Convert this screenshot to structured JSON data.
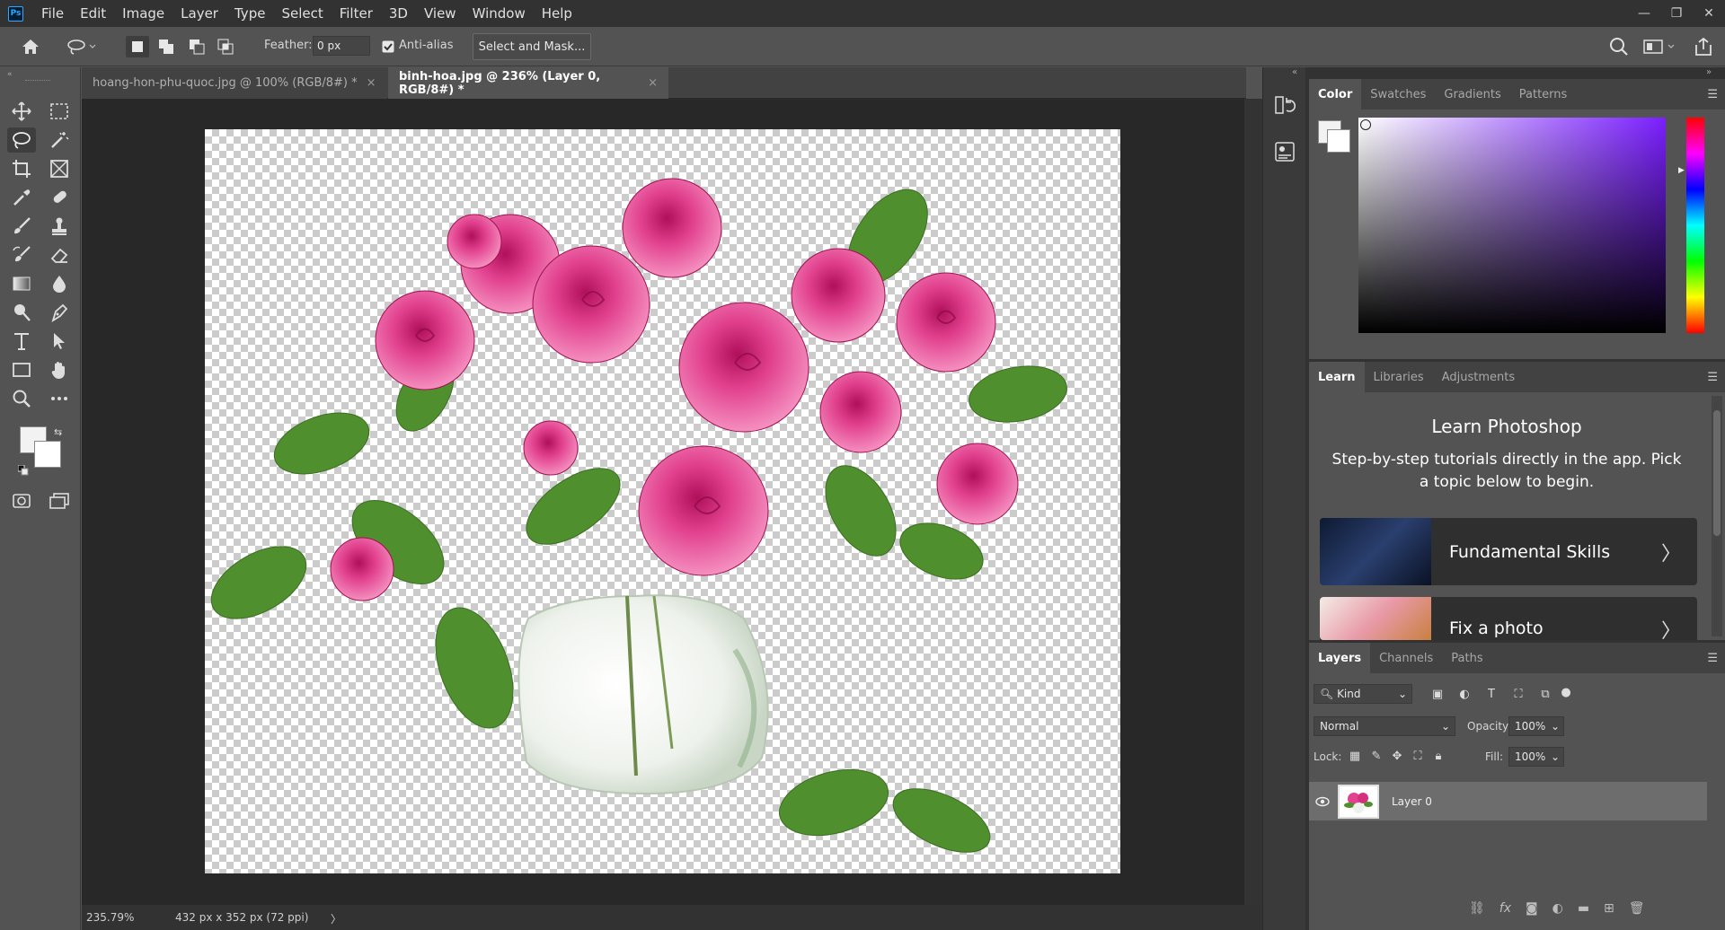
{
  "app": {
    "logo": "Ps"
  },
  "menu": {
    "items": [
      "File",
      "Edit",
      "Image",
      "Layer",
      "Type",
      "Select",
      "Filter",
      "3D",
      "View",
      "Window",
      "Help"
    ]
  },
  "window_controls": {
    "minimize": "—",
    "restore": "❐",
    "close": "✕"
  },
  "options": {
    "feather_label": "Feather:",
    "feather_value": "0 px",
    "anti_alias_label": "Anti-alias",
    "anti_alias_checked": true,
    "select_mask_label": "Select and Mask..."
  },
  "tabs": [
    {
      "label": "hoang-hon-phu-quoc.jpg @ 100% (RGB/8#) *",
      "close": "×"
    },
    {
      "label": "binh-hoa.jpg @ 236% (Layer 0, RGB/8#) *",
      "close": "×"
    }
  ],
  "status": {
    "zoom": "235.79%",
    "doc_info": "432 px x 352 px (72 ppi)",
    "arrow": "〉"
  },
  "color_panel": {
    "tabs": [
      "Color",
      "Swatches",
      "Gradients",
      "Patterns"
    ],
    "hue_color": "#7a1fff"
  },
  "learn_panel": {
    "tabs": [
      "Learn",
      "Libraries",
      "Adjustments"
    ],
    "title": "Learn Photoshop",
    "subtitle": "Step-by-step tutorials directly in the app. Pick a topic below to begin.",
    "cards": [
      {
        "title": "Fundamental Skills",
        "chevron": "〉"
      },
      {
        "title": "Fix a photo",
        "chevron": "〉"
      }
    ]
  },
  "layers_panel": {
    "tabs": [
      "Layers",
      "Channels",
      "Paths"
    ],
    "filter_kind": "Kind",
    "blend_mode": "Normal",
    "opacity_label": "Opacity:",
    "opacity_value": "100%",
    "lock_label": "Lock:",
    "fill_label": "Fill:",
    "fill_value": "100%",
    "layers": [
      {
        "name": "Layer 0",
        "visible": true
      }
    ]
  }
}
